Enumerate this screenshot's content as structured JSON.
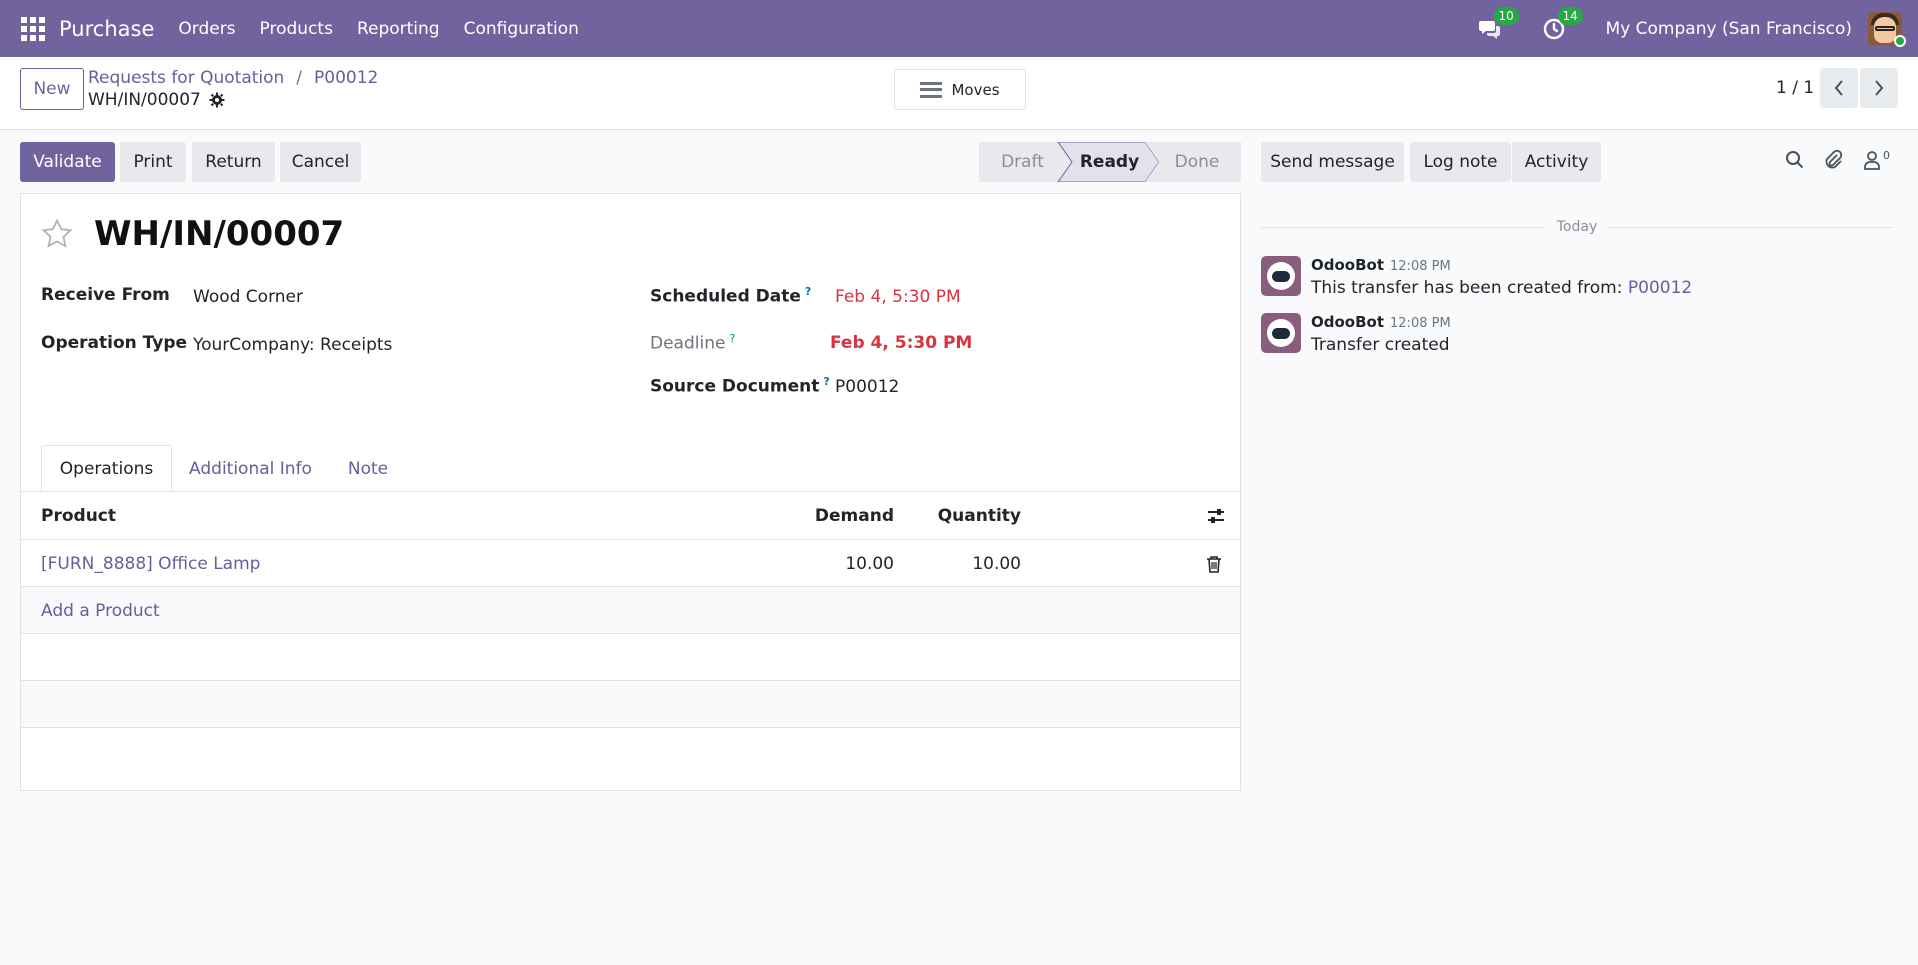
{
  "navbar": {
    "app_name": "Purchase",
    "menu": [
      "Orders",
      "Products",
      "Reporting",
      "Configuration"
    ],
    "messages_count": "10",
    "activities_count": "14",
    "company": "My Company (San Francisco)"
  },
  "control_panel": {
    "new_label": "New",
    "breadcrumb": [
      "Requests for Quotation",
      "P00012"
    ],
    "current_record": "WH/IN/00007",
    "moves_label": "Moves",
    "pager": "1 / 1"
  },
  "actions": {
    "validate": "Validate",
    "print": "Print",
    "return": "Return",
    "cancel": "Cancel"
  },
  "stages": [
    {
      "label": "Draft",
      "active": false
    },
    {
      "label": "Ready",
      "active": true
    },
    {
      "label": "Done",
      "active": false
    }
  ],
  "form": {
    "title": "WH/IN/00007",
    "receive_from_label": "Receive From",
    "receive_from": "Wood Corner",
    "operation_type_label": "Operation Type",
    "operation_type": "YourCompany: Receipts",
    "scheduled_date_label": "Scheduled Date",
    "scheduled_date": "Feb 4, 5:30 PM",
    "deadline_label": "Deadline",
    "deadline": "Feb 4, 5:30 PM",
    "source_document_label": "Source Document",
    "source_document": "P00012",
    "help_mark": "?"
  },
  "tabs": [
    "Operations",
    "Additional Info",
    "Note"
  ],
  "operations": {
    "columns": {
      "product": "Product",
      "demand": "Demand",
      "quantity": "Quantity"
    },
    "rows": [
      {
        "product": "[FURN_8888] Office Lamp",
        "demand": "10.00",
        "quantity": "10.00"
      }
    ],
    "add_label": "Add a Product"
  },
  "chatter": {
    "send_message": "Send message",
    "log_note": "Log note",
    "activity": "Activity",
    "followers_count": "0",
    "date_separator": "Today",
    "messages": [
      {
        "author": "OdooBot",
        "time": "12:08 PM",
        "text": "This transfer has been created from: ",
        "link": "P00012"
      },
      {
        "author": "OdooBot",
        "time": "12:08 PM",
        "text": "Transfer created",
        "link": ""
      }
    ]
  },
  "colors": {
    "brand": "#71639e",
    "link": "#6c5b9b",
    "danger": "#d9333f",
    "badge": "#28a745"
  }
}
